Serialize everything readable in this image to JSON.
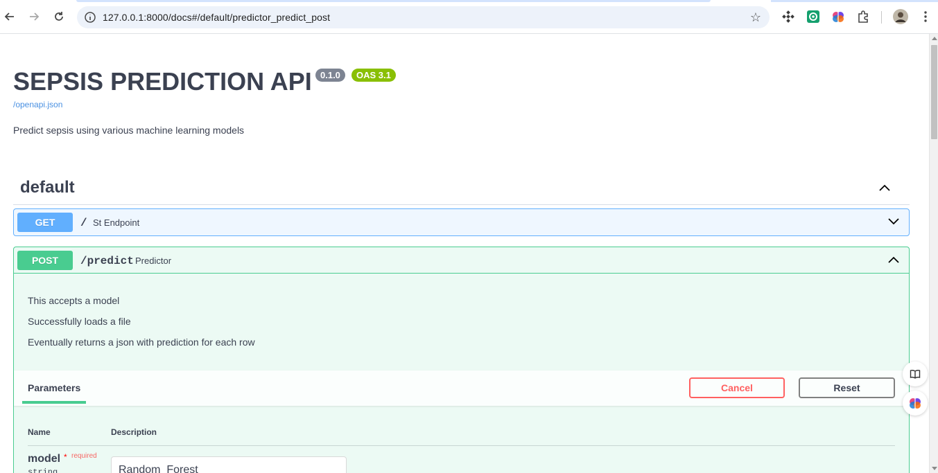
{
  "browser": {
    "url": "127.0.0.1:8000/docs#/default/predictor_predict_post"
  },
  "api": {
    "title": "SEPSIS PREDICTION API",
    "version": "0.1.0",
    "oas_badge": "OAS 3.1",
    "openapi_link": "/openapi.json",
    "description": "Predict sepsis using various machine learning models"
  },
  "tag": {
    "name": "default"
  },
  "operations": [
    {
      "method": "GET",
      "path": "/",
      "summary": "St Endpoint"
    },
    {
      "method": "POST",
      "path": "/predict",
      "summary": "Predictor"
    }
  ],
  "post_details": {
    "description_lines": [
      "This accepts a model",
      "Successfully loads a file",
      "Eventually returns a json with prediction for each row"
    ],
    "parameters_tab": "Parameters",
    "cancel_label": "Cancel",
    "reset_label": "Reset",
    "columns": {
      "name": "Name",
      "description": "Description"
    },
    "param": {
      "name": "model",
      "required_star": "*",
      "required_label": "required",
      "type": "string",
      "value": "Random_Forest"
    }
  },
  "colors": {
    "get": "#61affe",
    "post": "#49cc90",
    "cancel": "#ff6060",
    "version_badge": "#7d8492",
    "oas_badge": "#89bf04"
  }
}
